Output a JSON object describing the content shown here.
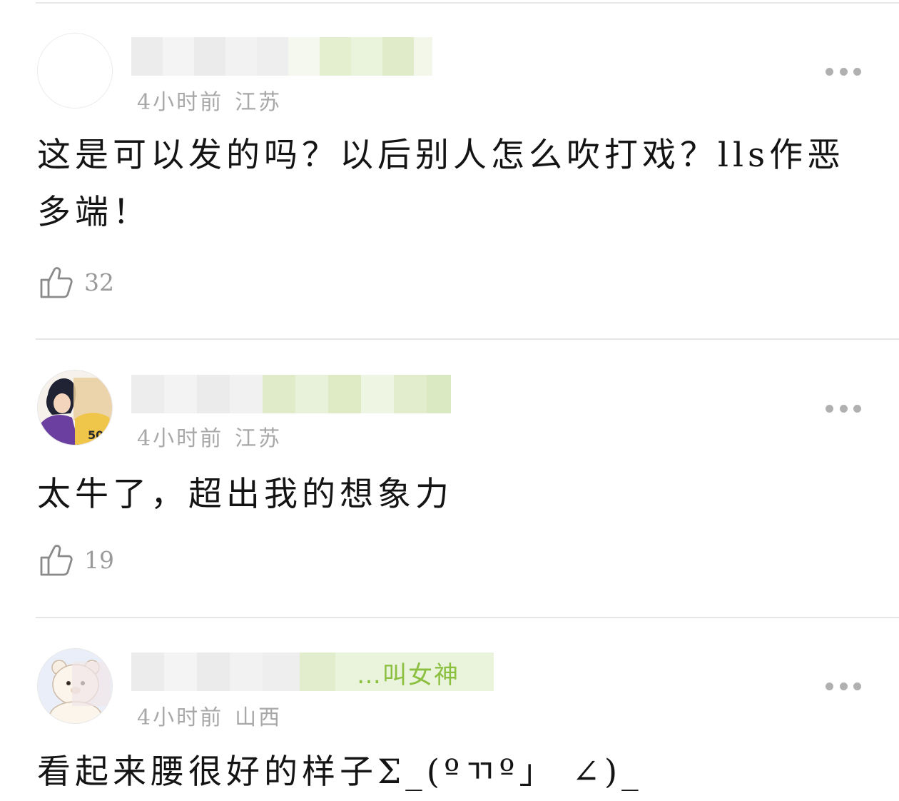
{
  "comments": [
    {
      "username": "",
      "time": "4小时前",
      "location": "江苏",
      "text": "这是可以发的吗？以后别人怎么吹打戏？lls作恶多端！",
      "likes": "32"
    },
    {
      "username": "",
      "time": "4小时前",
      "location": "江苏",
      "text": "太牛了，超出我的想象力",
      "likes": "19"
    },
    {
      "username": "…叫女神",
      "time": "4小时前",
      "location": "山西",
      "text": "看起来腰很好的样子Σ_(ºㄲº」 ∠)_",
      "likes": ""
    }
  ],
  "colors": {
    "username_green": "#8bbf3e",
    "meta_gray": "#a8a8a8",
    "divider": "#e6e6e6"
  },
  "icons": [
    "more-icon",
    "thumbs-up-icon"
  ]
}
